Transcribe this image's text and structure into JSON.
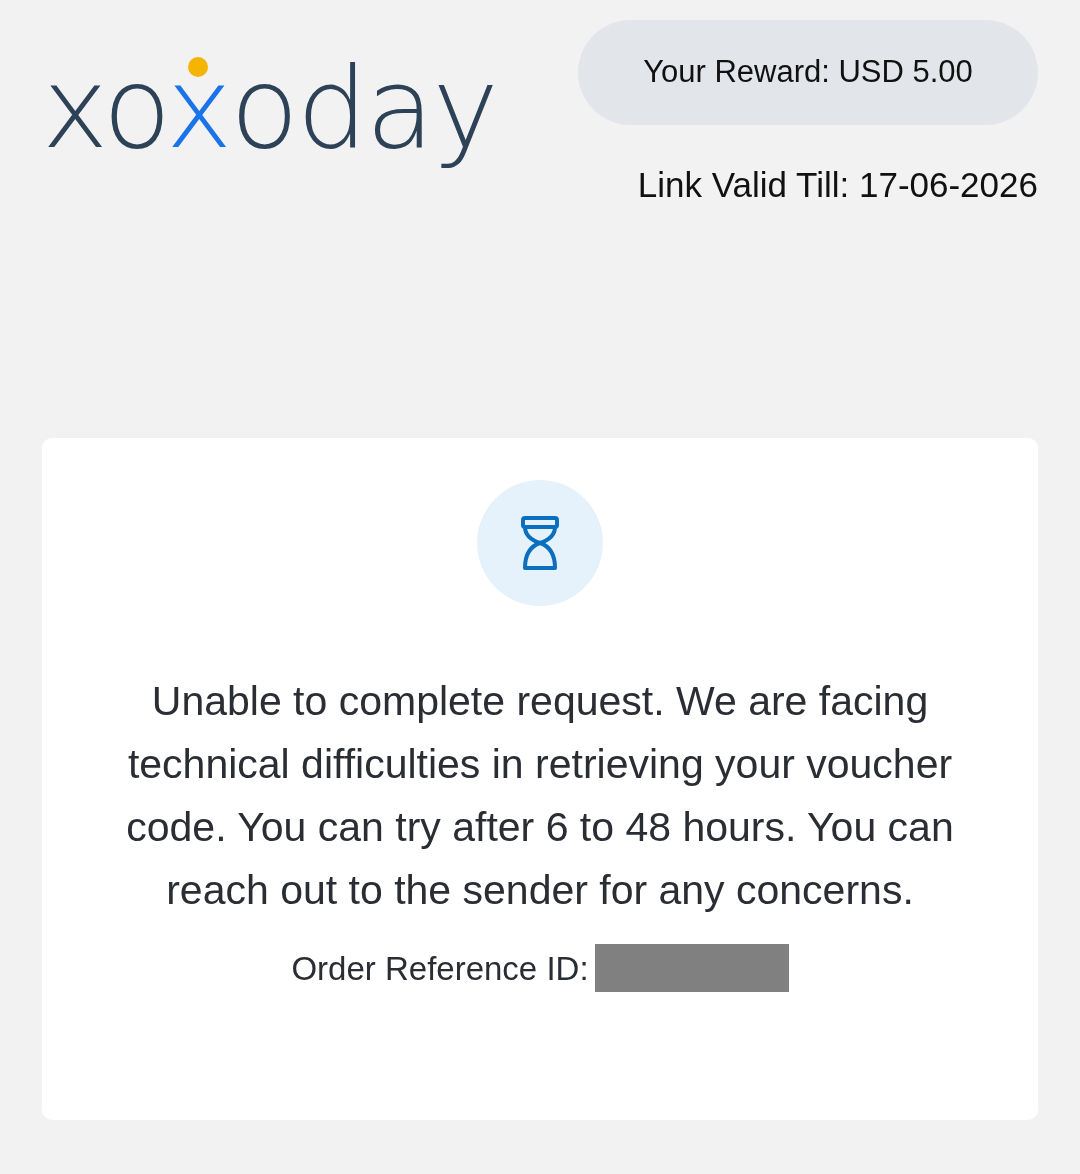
{
  "header": {
    "logo": "xoxoday",
    "reward": "Your Reward: USD 5.00",
    "validity": "Link Valid Till: 17-06-2026"
  },
  "card": {
    "message": "Unable to complete request. We are facing technical difficulties in retrieving your voucher code. You can try after 6 to 48 hours. You can reach out to the sender for any concerns.",
    "reference_label": "Order Reference ID:"
  }
}
